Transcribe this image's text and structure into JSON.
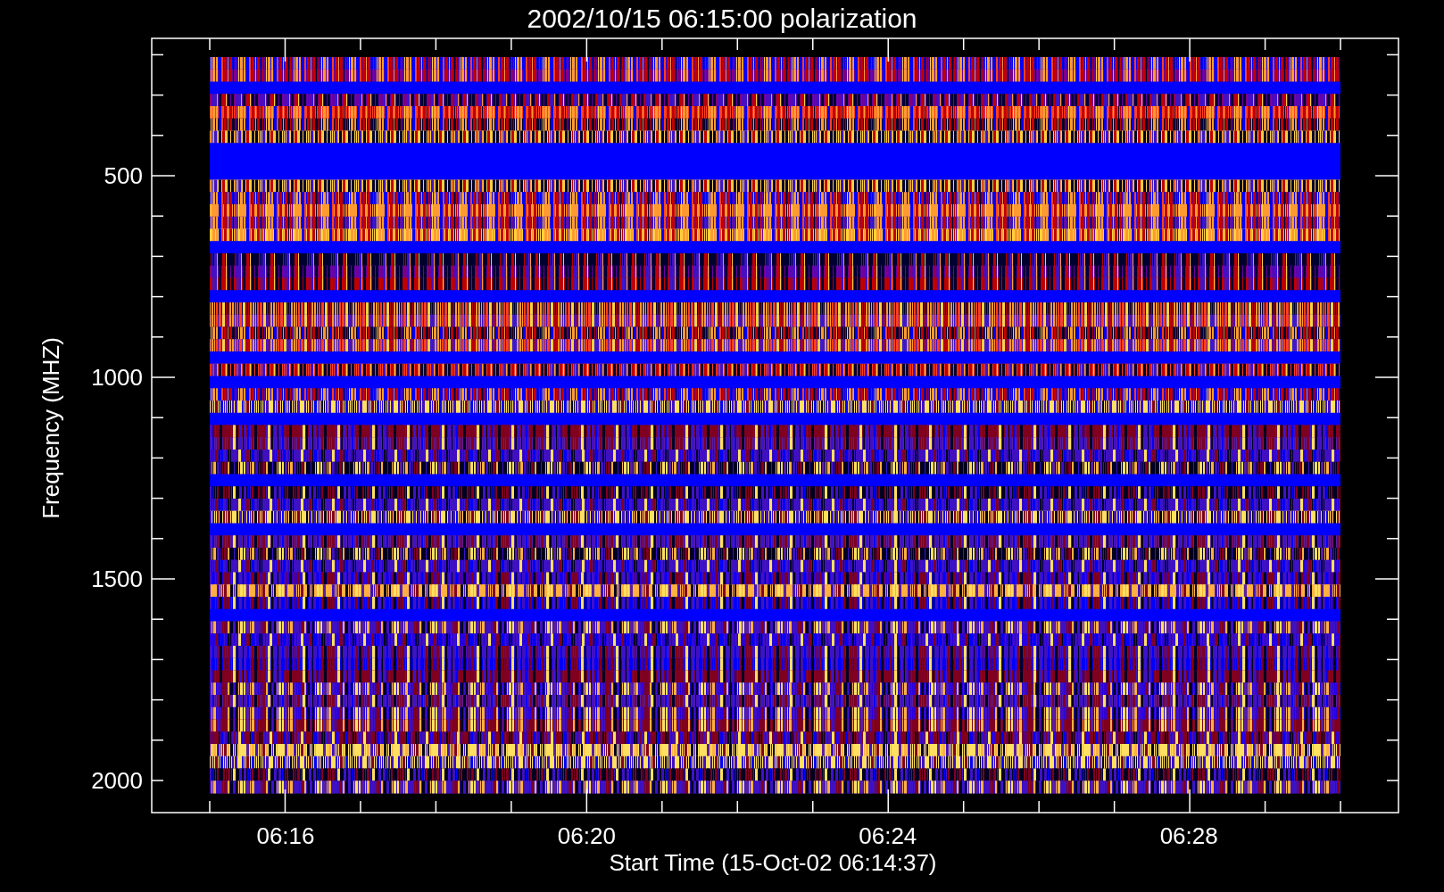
{
  "title": "2002/10/15 06:15:00 polarization",
  "y_axis": {
    "label": "Frequency (MHZ)",
    "ticks": [
      "500",
      "1000",
      "1500",
      "2000"
    ]
  },
  "x_axis": {
    "label": "Start Time (15-Oct-02 06:14:37)",
    "ticks": [
      "06:16",
      "06:20",
      "06:24",
      "06:28"
    ]
  }
}
